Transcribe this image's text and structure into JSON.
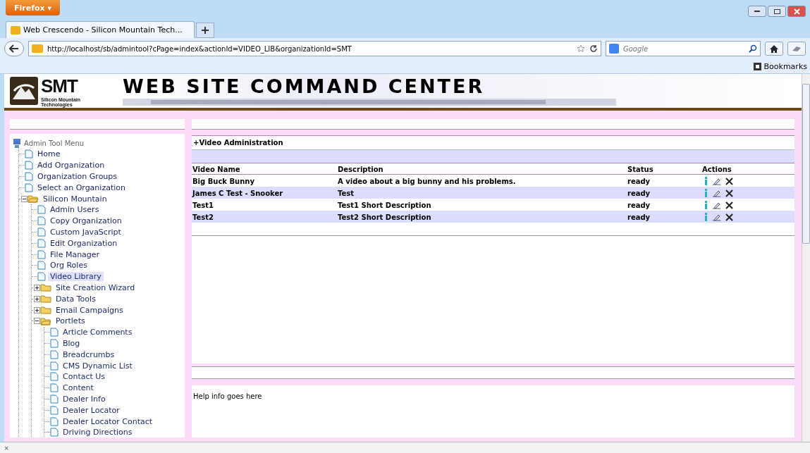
{
  "browser": {
    "menu_button": "Firefox",
    "menu_caret": "▾",
    "tab": {
      "title": "Web Crescendo - Silicon Mountain Tech...",
      "selected": true
    },
    "url": "http://localhost/sb/admintool?cPage=index&actionId=VIDEO_LIB&organizationId=SMT",
    "search_placeholder": "Google",
    "bookmarks": "Bookmarks"
  },
  "header": {
    "logo_big": "SMT",
    "logo_small": [
      "Silicon Mountain",
      "Technologies"
    ],
    "title": "WEB SITE COMMAND CENTER"
  },
  "sidebar": {
    "title": "Admin Tool Menu",
    "items": [
      {
        "label": "Home",
        "kind": "page",
        "selected": false
      },
      {
        "label": "Add Organization",
        "kind": "page",
        "selected": false
      },
      {
        "label": "Organization Groups",
        "kind": "page",
        "selected": false
      },
      {
        "label": "Select an Organization",
        "kind": "page",
        "selected": false
      },
      {
        "label": "Silicon Mountain",
        "kind": "folder",
        "expanded": true,
        "selected": false,
        "children": [
          {
            "label": "Admin Users",
            "kind": "page",
            "selected": false
          },
          {
            "label": "Copy Organization",
            "kind": "page",
            "selected": false
          },
          {
            "label": "Custom JavaScript",
            "kind": "page",
            "selected": false
          },
          {
            "label": "Edit Organization",
            "kind": "page",
            "selected": false
          },
          {
            "label": "File Manager",
            "kind": "page",
            "selected": false
          },
          {
            "label": "Org Roles",
            "kind": "page",
            "selected": false
          },
          {
            "label": "Video Library",
            "kind": "page",
            "selected": true
          },
          {
            "label": "Site Creation Wizard",
            "kind": "folder",
            "expanded": false,
            "selected": false
          },
          {
            "label": "Data Tools",
            "kind": "folder",
            "expanded": false,
            "selected": false
          },
          {
            "label": "Email Campaigns",
            "kind": "folder",
            "expanded": false,
            "selected": false
          },
          {
            "label": "Portlets",
            "kind": "folder",
            "expanded": true,
            "selected": false,
            "children": [
              {
                "label": "Article Comments",
                "kind": "page",
                "selected": false
              },
              {
                "label": "Blog",
                "kind": "page",
                "selected": false
              },
              {
                "label": "Breadcrumbs",
                "kind": "page",
                "selected": false
              },
              {
                "label": "CMS Dynamic List",
                "kind": "page",
                "selected": false
              },
              {
                "label": "Contact Us",
                "kind": "page",
                "selected": false
              },
              {
                "label": "Content",
                "kind": "page",
                "selected": false
              },
              {
                "label": "Dealer Info",
                "kind": "page",
                "selected": false
              },
              {
                "label": "Dealer Locator",
                "kind": "page",
                "selected": false
              },
              {
                "label": "Dealer Locator Contact",
                "kind": "page",
                "selected": false
              },
              {
                "label": "Driving Directions",
                "kind": "page",
                "selected": false
              }
            ]
          }
        ]
      }
    ]
  },
  "video_admin": {
    "title": "+Video Administration",
    "columns": [
      "Video Name",
      "Description",
      "Status",
      "Actions"
    ],
    "rows": [
      {
        "name": "Big Buck Bunny",
        "description": "A video about a big bunny and his problems.",
        "status": "ready"
      },
      {
        "name": "James C Test - Snooker",
        "description": "Test",
        "status": "ready"
      },
      {
        "name": "Test1",
        "description": "Test1 Short Description",
        "status": "ready"
      },
      {
        "name": "Test2",
        "description": "Test2 Short Description",
        "status": "ready"
      }
    ]
  },
  "help": {
    "text": "Help info goes here"
  },
  "status_bar": {
    "close": "×"
  }
}
